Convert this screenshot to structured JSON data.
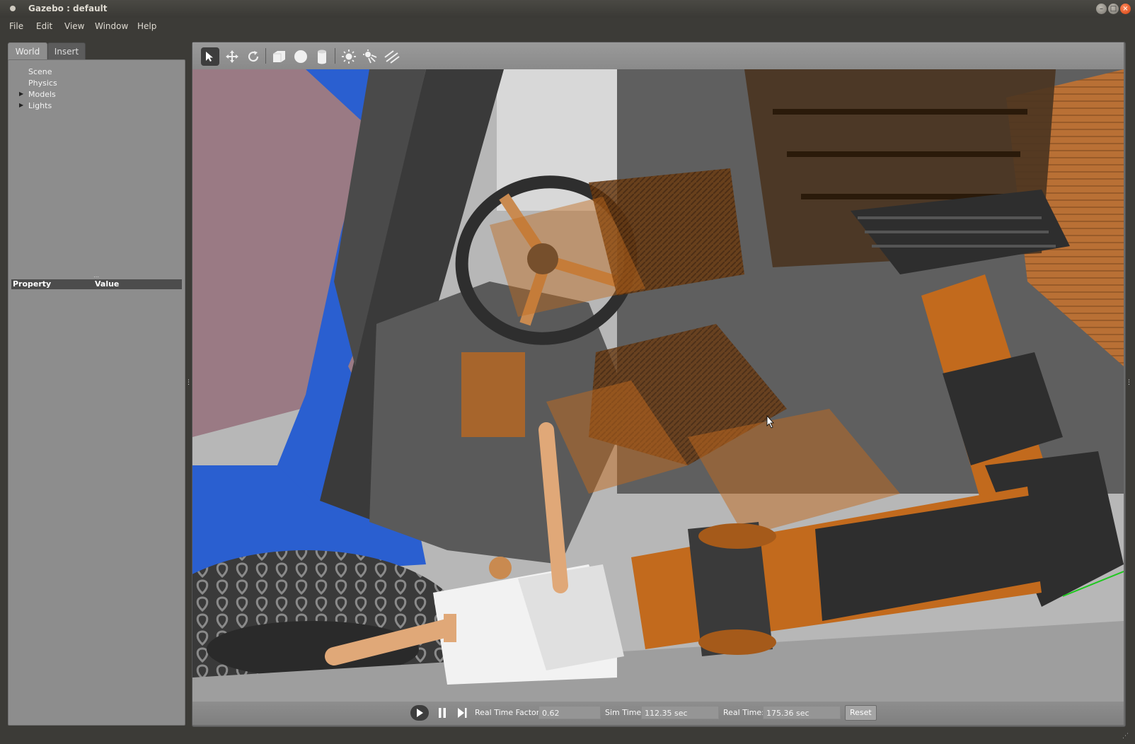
{
  "window": {
    "title": "Gazebo : default",
    "buttons": {
      "minimize": "–",
      "maximize": "□",
      "close": "×"
    }
  },
  "menu": [
    "File",
    "Edit",
    "View",
    "Window",
    "Help"
  ],
  "left_panel": {
    "tabs": [
      {
        "label": "World",
        "active": true
      },
      {
        "label": "Insert",
        "active": false
      }
    ],
    "tree": [
      {
        "label": "Scene",
        "expandable": false
      },
      {
        "label": "Physics",
        "expandable": false
      },
      {
        "label": "Models",
        "expandable": true
      },
      {
        "label": "Lights",
        "expandable": true
      }
    ],
    "property_header": {
      "property": "Property",
      "value": "Value"
    }
  },
  "toolbar": {
    "tools": [
      {
        "name": "select-tool",
        "icon": "arrow-cursor-icon",
        "selected": true
      },
      {
        "name": "translate-tool",
        "icon": "move-arrows-icon"
      },
      {
        "name": "rotate-tool",
        "icon": "rotate-icon"
      },
      {
        "name": "box-shape",
        "icon": "box-icon"
      },
      {
        "name": "sphere-shape",
        "icon": "sphere-icon"
      },
      {
        "name": "cylinder-shape",
        "icon": "cylinder-icon"
      },
      {
        "name": "point-light",
        "icon": "sun-icon"
      },
      {
        "name": "spot-light",
        "icon": "spotlight-icon"
      },
      {
        "name": "directional-light",
        "icon": "directional-light-icon"
      }
    ]
  },
  "status": {
    "real_time_factor_label": "Real Time Factor:",
    "real_time_factor": "0.62",
    "sim_time_label": "Sim Time:",
    "sim_time": "112.35 sec",
    "real_time_label": "Real Time:",
    "real_time": "175.36 sec",
    "reset_label": "Reset"
  },
  "colors": {
    "robot_orange": "#c26a1d",
    "vehicle_blue": "#2a5fd0",
    "panel_gray": "#8d8d8d",
    "chrome_dark": "#3c3b37"
  }
}
